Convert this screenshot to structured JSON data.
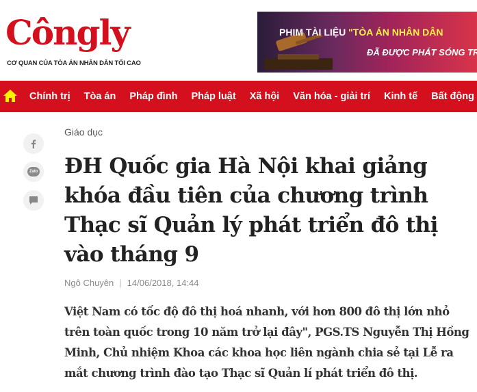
{
  "header": {
    "logo_text": "Côngly",
    "logo_tagline": "CƠ QUAN CỦA TÒA ÁN NHÂN DÂN TỐI CAO",
    "banner": {
      "line1_prefix": "PHIM TÀI LIỆU",
      "line1_highlight": "\"TÒA ÁN NHÂN DÂN",
      "line2": "ĐÃ ĐƯỢC PHÁT SÓNG TR"
    }
  },
  "nav": {
    "home_icon": "home-icon",
    "items": [
      {
        "label": "Chính trị"
      },
      {
        "label": "Tòa án"
      },
      {
        "label": "Pháp đình"
      },
      {
        "label": "Pháp luật"
      },
      {
        "label": "Xã hội"
      },
      {
        "label": "Văn hóa - giải trí"
      },
      {
        "label": "Kinh tế"
      },
      {
        "label": "Bất động"
      }
    ]
  },
  "share": {
    "facebook_icon": "facebook-icon",
    "zalo_icon": "zalo-icon",
    "zalo_label": "Zalo",
    "comment_icon": "comment-icon"
  },
  "article": {
    "category": "Giáo dục",
    "title": "ĐH Quốc gia Hà Nội khai giảng khóa đầu tiên của chương trình Thạc sĩ Quản lý phát triển đô thị vào tháng 9",
    "author": "Ngô Chuyên",
    "date": "14/06/2018, 14:44",
    "sapo": "Việt Nam có tốc độ đô thị hoá nhanh, với hơn 800 đô thị lớn nhỏ trên toàn quốc trong 10 năm trở lại đây\", PGS.TS Nguyễn Thị Hồng Minh, Chủ nhiệm Khoa các khoa học liên ngành chia sẻ tại Lễ ra mắt chương trình đào tạo Thạc sĩ Quản lí phát triển đô thị."
  },
  "colors": {
    "brand_red": "#d5101e",
    "text_dark": "#222222",
    "text_meta": "#888888"
  }
}
